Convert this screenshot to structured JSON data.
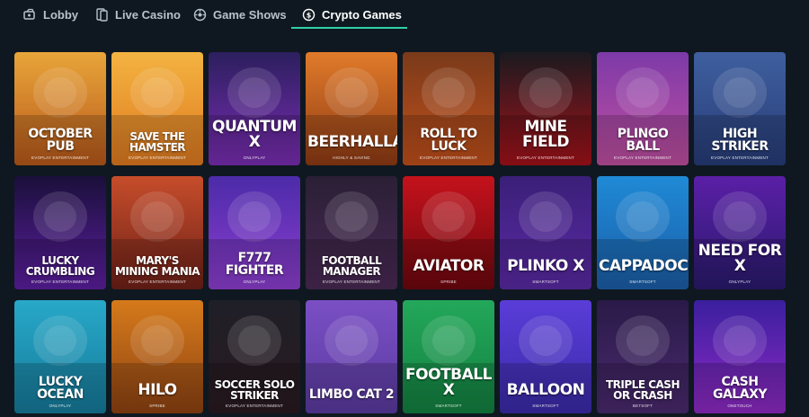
{
  "tabs": [
    {
      "label": "Lobby",
      "icon": "lobby-icon",
      "active": false
    },
    {
      "label": "Live Casino",
      "icon": "live-casino-icon",
      "active": false
    },
    {
      "label": "Game Shows",
      "icon": "game-shows-icon",
      "active": false
    },
    {
      "label": "Crypto Games",
      "icon": "crypto-icon",
      "active": true
    }
  ],
  "accent_color": "#2fd1a6",
  "rows": [
    [
      {
        "title": "OCTOBER PUB",
        "provider": "EVOPLAY ENTERTAINMENT",
        "colors": [
          "#e8a53a",
          "#b8581a"
        ]
      },
      {
        "title": "SAVE THE HAMSTER",
        "provider": "EVOPLAY ENTERTAINMENT",
        "colors": [
          "#f3b341",
          "#e07a1f"
        ]
      },
      {
        "title": "QUANTUM X",
        "provider": "ONLYPLAY",
        "colors": [
          "#2c1f5e",
          "#7a2db3"
        ]
      },
      {
        "title": "BEERHALLA",
        "provider": "HIGHLY & SAVING",
        "colors": [
          "#e07b2a",
          "#8e3a14"
        ]
      },
      {
        "title": "ROLL TO LUCK",
        "provider": "EVOPLAY ENTERTAINMENT",
        "colors": [
          "#7a3a1a",
          "#c2501c"
        ]
      },
      {
        "title": "MINE FIELD",
        "provider": "EVOPLAY ENTERTAINMENT",
        "colors": [
          "#1a1a1f",
          "#a5121a"
        ]
      },
      {
        "title": "PLINGO BALL",
        "provider": "EVOPLAY ENTERTAINMENT",
        "colors": [
          "#7d3aa8",
          "#c04fa0"
        ]
      },
      {
        "title": "HIGH STRIKER",
        "provider": "EVOPLAY ENTERTAINMENT",
        "colors": [
          "#3f5f9e",
          "#273c78"
        ]
      }
    ],
    [
      {
        "title": "LUCKY CRUMBLING",
        "provider": "EVOPLAY ENTERTAINMENT",
        "colors": [
          "#1a0f3a",
          "#5c1fa0"
        ]
      },
      {
        "title": "MARY'S MINING MANIA",
        "provider": "EVOPLAY ENTERTAINMENT",
        "colors": [
          "#c64d2b",
          "#6e2018"
        ]
      },
      {
        "title": "F777 FIGHTER",
        "provider": "ONLYPLAY",
        "colors": [
          "#4b2ba8",
          "#8e3ed0"
        ]
      },
      {
        "title": "FOOTBALL MANAGER",
        "provider": "EVOPLAY ENTERTAINMENT",
        "colors": [
          "#2a1f35",
          "#4a2a55"
        ]
      },
      {
        "title": "AVIATOR",
        "provider": "SPRIBE",
        "colors": [
          "#c4121c",
          "#6e070e"
        ]
      },
      {
        "title": "PLINKO X",
        "provider": "SMARTSOFT",
        "colors": [
          "#3a1f78",
          "#5b2aa5"
        ]
      },
      {
        "title": "CAPPADOCIA",
        "provider": "SMARTSOFT",
        "colors": [
          "#1f8ad6",
          "#1b5ea8"
        ]
      },
      {
        "title": "NEED FOR X",
        "provider": "ONLYPLAY",
        "colors": [
          "#5a1fa6",
          "#2a1a6e"
        ]
      }
    ],
    [
      {
        "title": "LUCKY OCEAN",
        "provider": "ONLYPLAY",
        "colors": [
          "#28a8c8",
          "#157a9a"
        ]
      },
      {
        "title": "HILO",
        "provider": "SPRIBE",
        "colors": [
          "#d57a1b",
          "#8e4212"
        ]
      },
      {
        "title": "SOCCER SOLO STRIKER",
        "provider": "EVOPLAY ENTERTAINMENT",
        "colors": [
          "#1f1f27",
          "#2a1a20"
        ]
      },
      {
        "title": "LIMBO CAT 2",
        "provider": "",
        "colors": [
          "#7a4fc4",
          "#5a3aa0"
        ]
      },
      {
        "title": "FOOTBALL X",
        "provider": "SMARTSOFT",
        "colors": [
          "#23a85a",
          "#138040"
        ]
      },
      {
        "title": "BALLOON",
        "provider": "SMARTSOFT",
        "colors": [
          "#5a3dd8",
          "#3a2aa8"
        ]
      },
      {
        "title": "TRIPLE CASH OR CRASH",
        "provider": "BETSOFT",
        "colors": [
          "#2a1a48",
          "#4a2a6e"
        ]
      },
      {
        "title": "CASH GALAXY",
        "provider": "ONETOUCH",
        "colors": [
          "#3a1f9e",
          "#8e2ac4"
        ]
      }
    ]
  ]
}
